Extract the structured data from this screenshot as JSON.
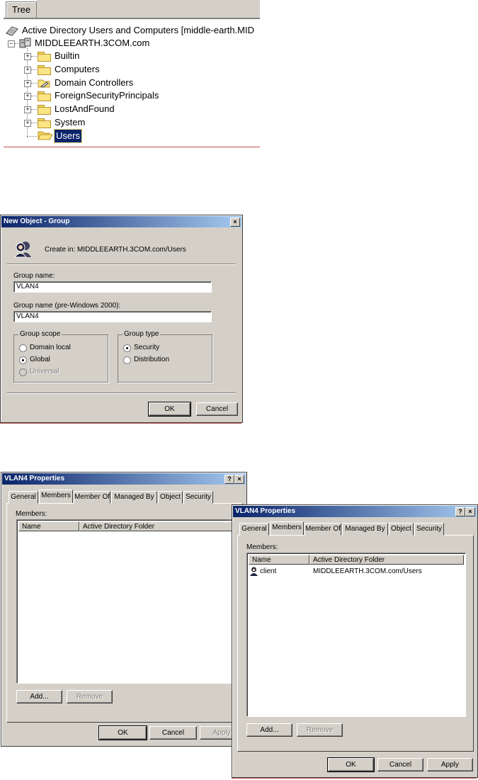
{
  "tree": {
    "tab_label": "Tree",
    "root_label": "Active Directory Users and Computers [middle-earth.MID",
    "domain_label": "MIDDLEEARTH.3COM.com",
    "items": [
      {
        "label": "Builtin"
      },
      {
        "label": "Computers"
      },
      {
        "label": "Domain Controllers"
      },
      {
        "label": "ForeignSecurityPrincipals"
      },
      {
        "label": "LostAndFound"
      },
      {
        "label": "System"
      },
      {
        "label": "Users"
      }
    ],
    "selected": "Users"
  },
  "new_group_dialog": {
    "title": "New Object - Group",
    "close_glyph": "×",
    "create_in_label": "Create in:",
    "create_in_value": "MIDDLEEARTH.3COM.com/Users",
    "group_name_label": "Group name:",
    "group_name_value": "VLAN4",
    "group_name_pre2000_label": "Group name (pre-Windows 2000):",
    "group_name_pre2000_value": "VLAN4",
    "scope": {
      "title": "Group scope",
      "options": [
        "Domain local",
        "Global",
        "Universal"
      ],
      "selected": "Global",
      "disabled": [
        "Universal"
      ]
    },
    "type": {
      "title": "Group type",
      "options": [
        "Security",
        "Distribution"
      ],
      "selected": "Security"
    },
    "ok_label": "OK",
    "cancel_label": "Cancel"
  },
  "props_dialog_1": {
    "title": "VLAN4 Properties",
    "help_glyph": "?",
    "close_glyph": "×",
    "tabs": [
      "General",
      "Members",
      "Member Of",
      "Managed By",
      "Object",
      "Security"
    ],
    "active_tab": "Members",
    "members_label": "Members:",
    "columns": [
      "Name",
      "Active Directory Folder"
    ],
    "rows": [],
    "add_label": "Add...",
    "remove_label": "Remove",
    "ok_label": "OK",
    "cancel_label": "Cancel",
    "apply_label": "Apply"
  },
  "props_dialog_2": {
    "title": "VLAN4 Properties",
    "help_glyph": "?",
    "close_glyph": "×",
    "tabs": [
      "General",
      "Members",
      "Member Of",
      "Managed By",
      "Object",
      "Security"
    ],
    "active_tab": "Members",
    "members_label": "Members:",
    "columns": [
      "Name",
      "Active Directory Folder"
    ],
    "rows": [
      {
        "name": "client",
        "folder": "MIDDLEEARTH.3COM.com/Users"
      }
    ],
    "add_label": "Add...",
    "remove_label": "Remove",
    "ok_label": "OK",
    "cancel_label": "Cancel",
    "apply_label": "Apply"
  },
  "colors": {
    "dialog_face": "#d4d0c8",
    "title_gradient_start": "#0a246a",
    "title_gradient_end": "#a6caf0",
    "selection": "#0a246a",
    "folder": "#fbe483",
    "annotation_line": "#c0504d"
  }
}
